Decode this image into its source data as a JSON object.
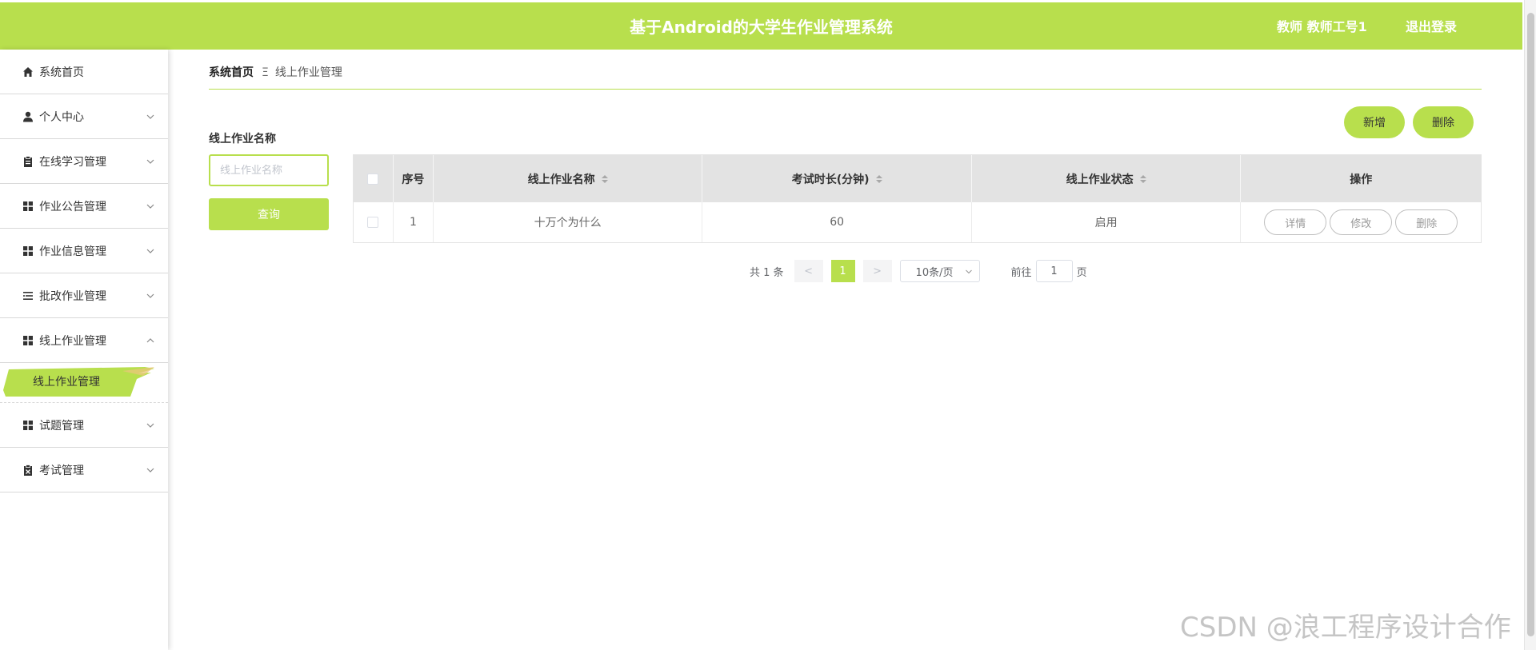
{
  "header": {
    "title": "基于Android的大学生作业管理系统",
    "user": "教师 教师工号1",
    "logout": "退出登录",
    "color": "#b8df4d"
  },
  "sidebar": {
    "items": [
      {
        "label": "系统首页",
        "icon": "home-icon"
      },
      {
        "label": "个人中心",
        "icon": "user-icon"
      },
      {
        "label": "在线学习管理",
        "icon": "clipboard-icon"
      },
      {
        "label": "作业公告管理",
        "icon": "grid-icon"
      },
      {
        "label": "作业信息管理",
        "icon": "grid-icon"
      },
      {
        "label": "批改作业管理",
        "icon": "list-icon"
      },
      {
        "label": "线上作业管理",
        "icon": "grid-icon"
      },
      {
        "label": "试题管理",
        "icon": "grid-icon"
      },
      {
        "label": "考试管理",
        "icon": "clipboard-x-icon"
      }
    ],
    "active_sub": "线上作业管理"
  },
  "breadcrumb": {
    "home": "系统首页",
    "separator": "Ξ",
    "current": "线上作业管理"
  },
  "filter": {
    "label": "线上作业名称",
    "placeholder": "线上作业名称",
    "query_button": "查询"
  },
  "actions": {
    "add": "新增",
    "delete": "删除"
  },
  "table": {
    "columns": [
      "序号",
      "线上作业名称",
      "考试时长(分钟)",
      "线上作业状态",
      "操作"
    ],
    "rows": [
      {
        "index": "1",
        "name": "十万个为什么",
        "duration": "60",
        "status": "启用"
      }
    ],
    "row_actions": [
      "详情",
      "修改",
      "删除"
    ]
  },
  "pagination": {
    "total": "共 1 条",
    "prev": "<",
    "current_page": "1",
    "next": ">",
    "page_size": "10条/页",
    "goto_label": "前往",
    "goto_value": "1",
    "page_unit": "页"
  },
  "watermark": "CSDN @浪工程序设计合作"
}
